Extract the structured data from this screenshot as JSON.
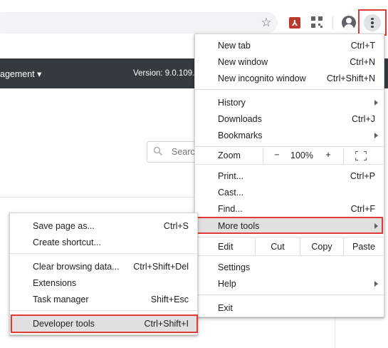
{
  "toolbar": {
    "icons": [
      "bookmark-star-icon",
      "pdf-extension-icon",
      "qr-code-icon",
      "profile-avatar-icon",
      "chrome-menu-icon"
    ],
    "star_glyph": "☆",
    "pdf_glyph": "⅄"
  },
  "page": {
    "nav_title": "agement",
    "version": "Version: 9.0.109.0",
    "search_placeholder": "Search"
  },
  "main_menu": {
    "new_tab": {
      "label": "New tab",
      "shortcut": "Ctrl+T"
    },
    "new_window": {
      "label": "New window",
      "shortcut": "Ctrl+N"
    },
    "new_incognito": {
      "label": "New incognito window",
      "shortcut": "Ctrl+Shift+N"
    },
    "history": {
      "label": "History"
    },
    "downloads": {
      "label": "Downloads",
      "shortcut": "Ctrl+J"
    },
    "bookmarks": {
      "label": "Bookmarks"
    },
    "zoom": {
      "label": "Zoom",
      "minus": "−",
      "value": "100%",
      "plus": "+"
    },
    "print": {
      "label": "Print...",
      "shortcut": "Ctrl+P"
    },
    "cast": {
      "label": "Cast..."
    },
    "find": {
      "label": "Find...",
      "shortcut": "Ctrl+F"
    },
    "more_tools": {
      "label": "More tools"
    },
    "edit": {
      "label": "Edit",
      "cut": "Cut",
      "copy": "Copy",
      "paste": "Paste"
    },
    "settings": {
      "label": "Settings"
    },
    "help": {
      "label": "Help"
    },
    "exit": {
      "label": "Exit"
    }
  },
  "sub_menu": {
    "save_page": {
      "label": "Save page as...",
      "shortcut": "Ctrl+S"
    },
    "create_shortcut": {
      "label": "Create shortcut..."
    },
    "clear_browsing": {
      "label": "Clear browsing data...",
      "shortcut": "Ctrl+Shift+Del"
    },
    "extensions": {
      "label": "Extensions"
    },
    "task_manager": {
      "label": "Task manager",
      "shortcut": "Shift+Esc"
    },
    "developer_tools": {
      "label": "Developer tools",
      "shortcut": "Ctrl+Shift+I"
    }
  },
  "colors": {
    "highlight_box": "#e53935",
    "hover_row": "#e0e0e0",
    "page_bar": "#343a40"
  }
}
